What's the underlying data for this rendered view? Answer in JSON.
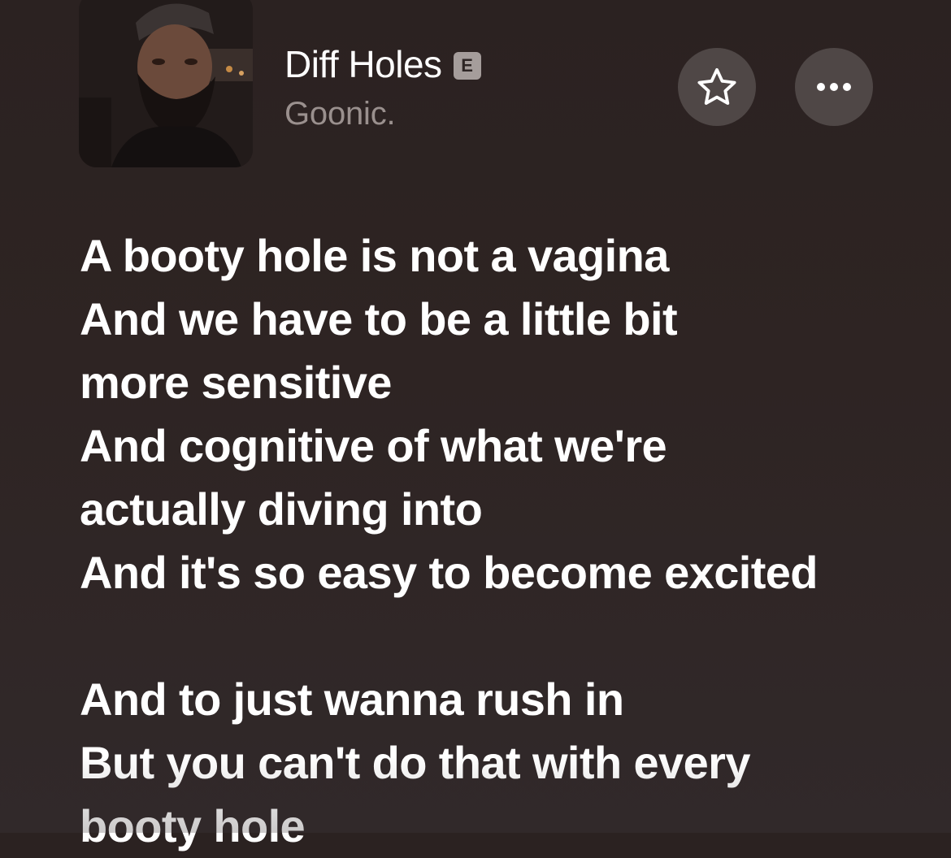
{
  "now_playing": {
    "title": "Diff Holes",
    "explicit_badge": "E",
    "artist": "Goonic.",
    "artwork_icon": "album-artwork"
  },
  "controls": {
    "favorite_icon": "star-outline-icon",
    "more_icon": "ellipsis-icon"
  },
  "lyrics": {
    "lines": [
      "A booty hole is not a vagina",
      "And we have to be a little bit",
      "more sensitive",
      "And cognitive of what we're",
      "actually diving into",
      "And it's so easy to become excited",
      "",
      "And to just wanna rush in",
      "But you can't do that with every",
      "booty hole"
    ]
  },
  "colors": {
    "background": "#2e2423",
    "button_fill": "#4f4746",
    "artist_text": "#9a908e",
    "badge_fill": "#a59d9b"
  }
}
